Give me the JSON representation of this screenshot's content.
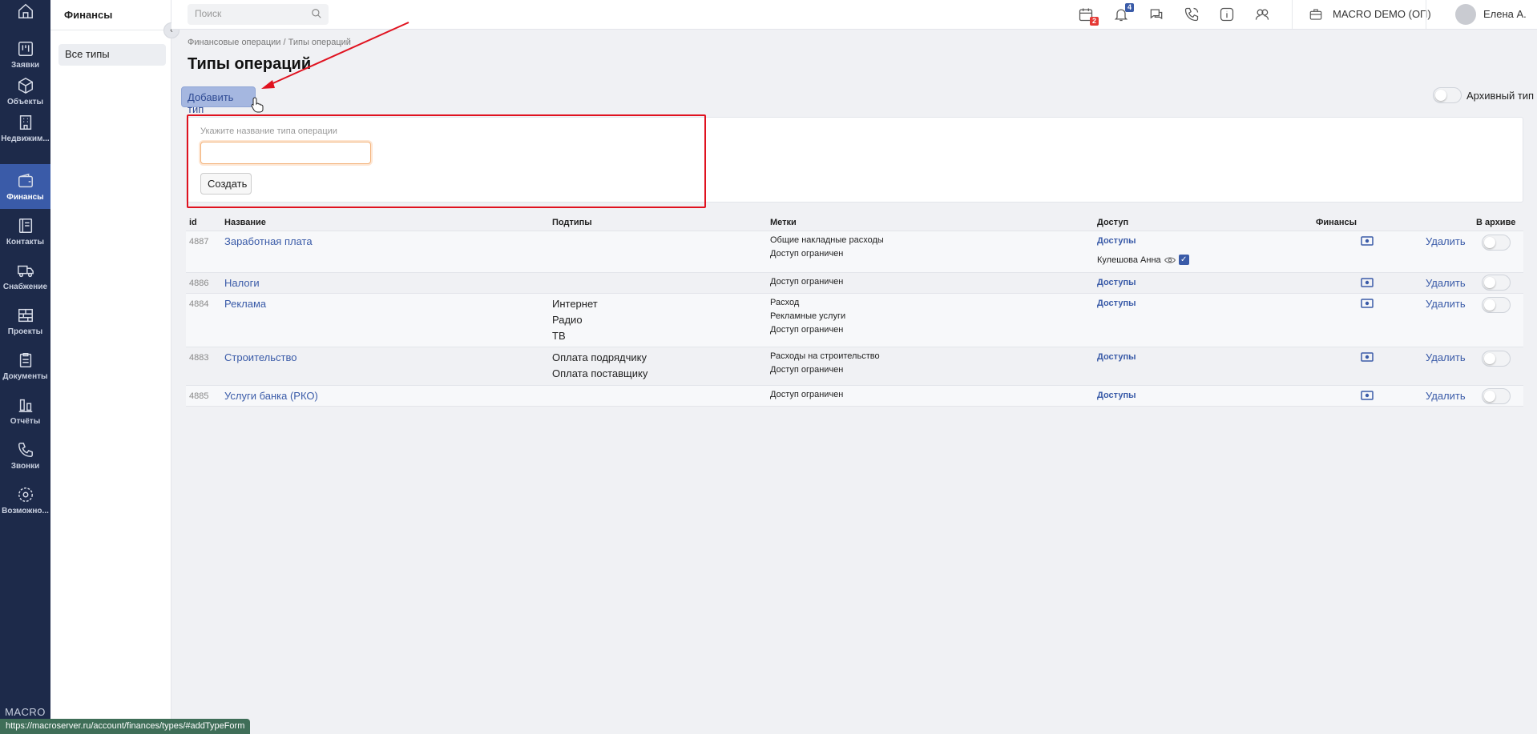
{
  "nav": {
    "items": [
      {
        "label": "",
        "icon": "home-icon"
      },
      {
        "label": "Заявки",
        "icon": "kanban-icon"
      },
      {
        "label": "Объекты",
        "icon": "cube-icon"
      },
      {
        "label": "Недвижим...",
        "icon": "building-icon"
      },
      {
        "label": "Финансы",
        "icon": "wallet-icon"
      },
      {
        "label": "Контакты",
        "icon": "contacts-icon"
      },
      {
        "label": "Снабжение",
        "icon": "truck-icon"
      },
      {
        "label": "Проекты",
        "icon": "projects-icon"
      },
      {
        "label": "Документы",
        "icon": "clipboard-icon"
      },
      {
        "label": "Отчёты",
        "icon": "reports-icon"
      },
      {
        "label": "Звонки",
        "icon": "phone-icon"
      },
      {
        "label": "Возможно...",
        "icon": "settings-icon"
      }
    ],
    "active_index": 4,
    "brand": "MACRO"
  },
  "subnav": {
    "title": "Финансы",
    "items": [
      "Все типы"
    ]
  },
  "topbar": {
    "search_placeholder": "Поиск",
    "calendar_badge": "2",
    "bell_badge": "4",
    "company": "MACRO DEMO (ОП)",
    "user": "Елена А."
  },
  "breadcrumb": "Финансовые операции  /  Типы операций",
  "page_title": "Типы операций",
  "add_button": "Добавить тип",
  "archive_label": "Архивный тип",
  "form": {
    "label": "Укажите название типа операции",
    "value": "",
    "create_button": "Создать"
  },
  "table": {
    "headers": {
      "id": "id",
      "name": "Название",
      "subtypes": "Подтипы",
      "tags": "Метки",
      "access": "Доступ",
      "finances": "Финансы",
      "archive": "В архиве"
    },
    "access_link": "Доступы",
    "delete_label": "Удалить",
    "rows": [
      {
        "id": "4887",
        "name": "Заработная плата",
        "subtypes": [],
        "tags": [
          "Общие накладные расходы",
          "Доступ ограничен"
        ],
        "restricted_user": "Кулешова Анна"
      },
      {
        "id": "4886",
        "name": "Налоги",
        "subtypes": [],
        "tags": [
          "Доступ ограничен"
        ]
      },
      {
        "id": "4884",
        "name": "Реклама",
        "subtypes": [
          "Интернет",
          "Радио",
          "ТВ"
        ],
        "tags": [
          "Расход",
          "Рекламные услуги",
          "Доступ ограничен"
        ]
      },
      {
        "id": "4883",
        "name": "Строительство",
        "subtypes": [
          "Оплата подрядчику",
          "Оплата поставщику"
        ],
        "tags": [
          "Расходы на строительство",
          "Доступ ограничен"
        ]
      },
      {
        "id": "4885",
        "name": "Услуги банка (РКО)",
        "subtypes": [],
        "tags": [
          "Доступ ограничен"
        ]
      }
    ]
  },
  "status_url": "https://macroserver.ru/account/finances/types/#addTypeForm",
  "colors": {
    "nav_bg": "#1d2a4a",
    "nav_active": "#3a5ba8",
    "link": "#3a5ba8",
    "highlight": "#e0121f"
  }
}
